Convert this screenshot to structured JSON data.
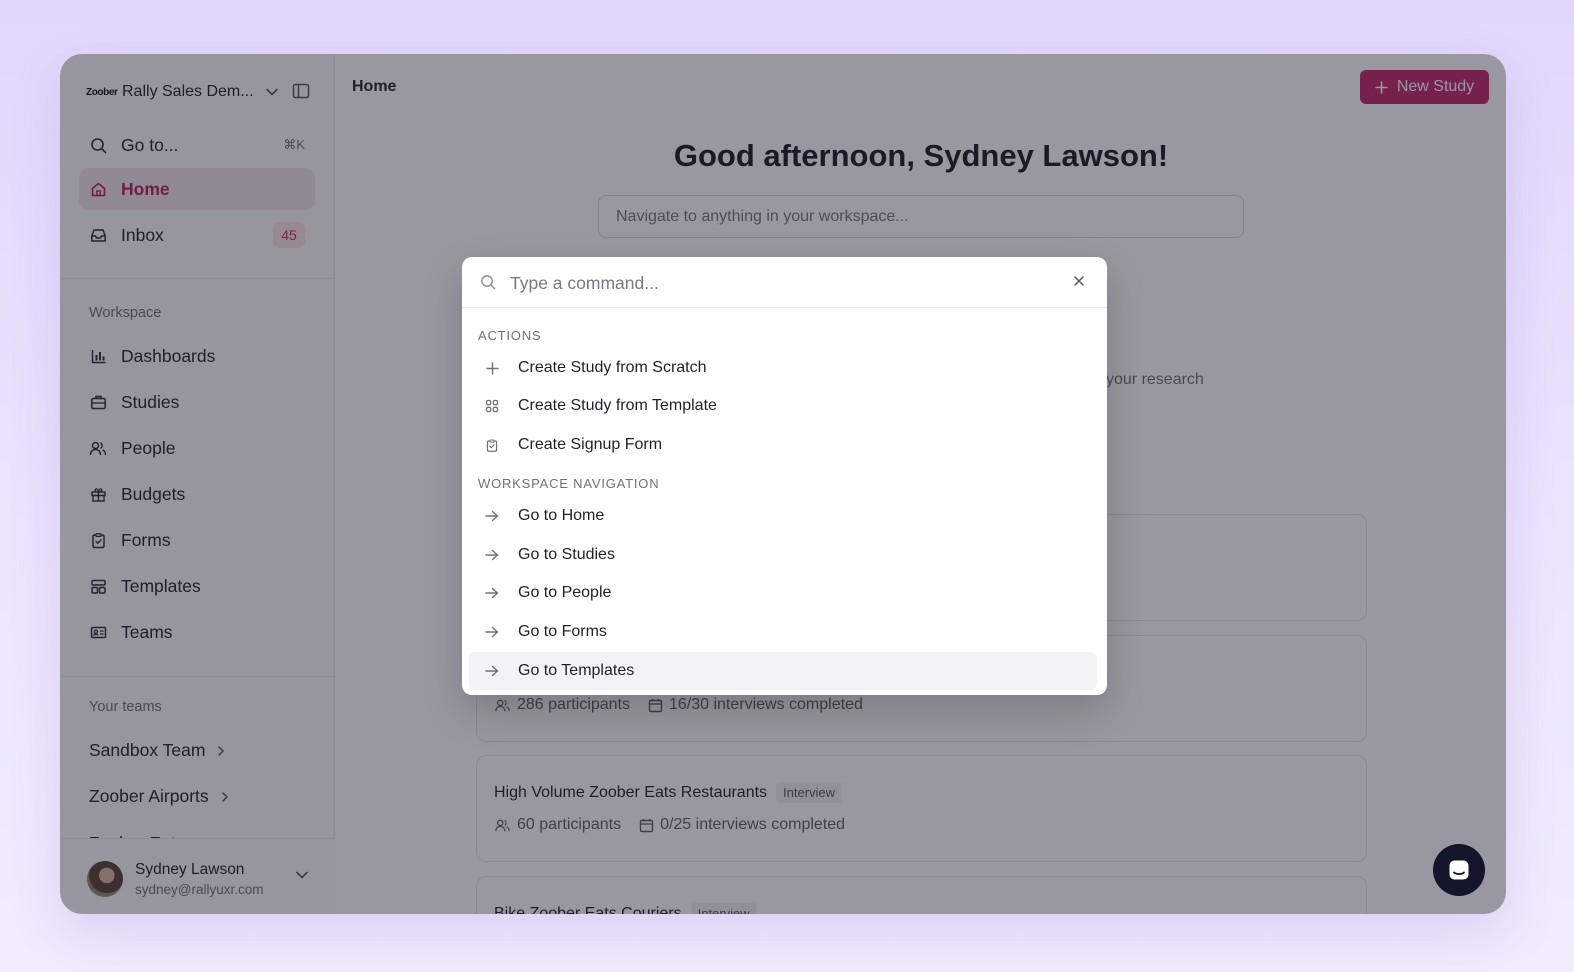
{
  "workspace": {
    "logo_text": "Zoober",
    "name": "Rally Sales Dem..."
  },
  "sidebar": {
    "goto": {
      "label": "Go to...",
      "shortcut": "⌘K"
    },
    "home": {
      "label": "Home"
    },
    "inbox": {
      "label": "Inbox",
      "count": "45"
    },
    "workspace_label": "Workspace",
    "items": [
      {
        "label": "Dashboards",
        "icon": "chart-icon"
      },
      {
        "label": "Studies",
        "icon": "briefcase-icon"
      },
      {
        "label": "People",
        "icon": "users-icon"
      },
      {
        "label": "Budgets",
        "icon": "gift-icon"
      },
      {
        "label": "Forms",
        "icon": "clipboard-icon"
      },
      {
        "label": "Templates",
        "icon": "layout-icon"
      },
      {
        "label": "Teams",
        "icon": "id-card-icon"
      }
    ],
    "teams_label": "Your teams",
    "teams": [
      {
        "label": "Sandbox Team"
      },
      {
        "label": "Zoober Airports"
      },
      {
        "label": "Zoober Eats"
      }
    ]
  },
  "profile": {
    "name": "Sydney Lawson",
    "email": "sydney@rallyuxr.com"
  },
  "main": {
    "breadcrumb": "Home",
    "new_study_label": "New Study",
    "greeting": "Good afternoon, Sydney Lawson!",
    "search_placeholder": "Navigate to anything in your workspace...",
    "hint_fragment": "your research",
    "cards": [
      {
        "title": "",
        "tag": "",
        "participants": "",
        "progress": ""
      },
      {
        "title": "",
        "tag": "",
        "participants": "286 participants",
        "progress": "16/30 interviews completed"
      },
      {
        "title": "High Volume Zoober Eats Restaurants",
        "tag": "Interview",
        "participants": "60 participants",
        "progress": "0/25 interviews completed"
      },
      {
        "title": "Bike Zoober Eats Couriers",
        "tag": "Interview",
        "participants": "",
        "progress": ""
      }
    ]
  },
  "palette": {
    "placeholder": "Type a command...",
    "actions_label": "ACTIONS",
    "actions": [
      {
        "label": "Create Study from Scratch",
        "icon": "plus-icon"
      },
      {
        "label": "Create Study from Template",
        "icon": "template-grid-icon"
      },
      {
        "label": "Create Signup Form",
        "icon": "clipboard-check-icon"
      }
    ],
    "nav_label": "WORKSPACE NAVIGATION",
    "navigation": [
      {
        "label": "Go to Home"
      },
      {
        "label": "Go to Studies"
      },
      {
        "label": "Go to People"
      },
      {
        "label": "Go to Forms"
      },
      {
        "label": "Go to Templates",
        "selected": true
      }
    ]
  },
  "colors": {
    "accent": "#c12a6b",
    "active_bg": "#f1e6ea",
    "badge_bg": "#fbe3e6",
    "badge_text": "#c23347"
  }
}
